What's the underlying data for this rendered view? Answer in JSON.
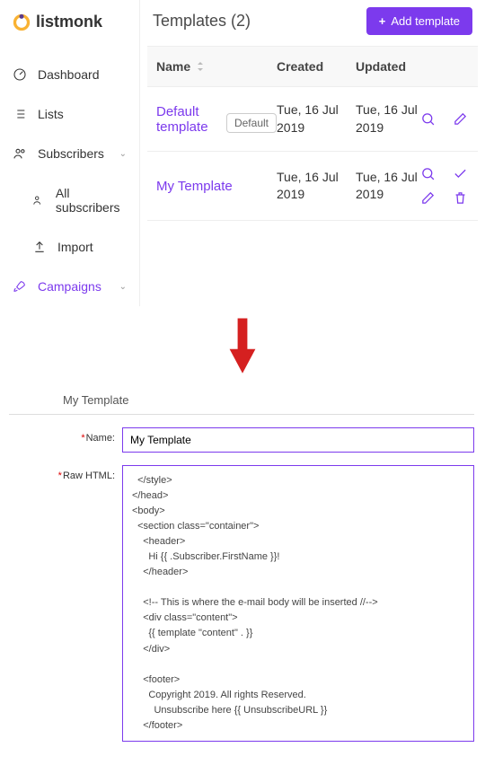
{
  "brand": "listmonk",
  "sidebar": {
    "items": [
      {
        "label": "Dashboard"
      },
      {
        "label": "Lists"
      },
      {
        "label": "Subscribers"
      },
      {
        "label": "All subscribers"
      },
      {
        "label": "Import"
      },
      {
        "label": "Campaigns"
      }
    ]
  },
  "page": {
    "title": "Templates (2)",
    "add_button": "Add template"
  },
  "table": {
    "headers": {
      "name": "Name",
      "created": "Created",
      "updated": "Updated"
    },
    "rows": [
      {
        "name": "Default template",
        "badge": "Default",
        "created": "Tue, 16 Jul 2019",
        "updated": "Tue, 16 Jul 2019"
      },
      {
        "name": "My Template",
        "badge": "",
        "created": "Tue, 16 Jul 2019",
        "updated": "Tue, 16 Jul 2019"
      }
    ]
  },
  "editor": {
    "title": "My Template",
    "name_label": "Name:",
    "name_value": "My Template",
    "html_label": "Raw HTML:",
    "html_value": "  </style>\n</head>\n<body>\n  <section class=\"container\">\n    <header>\n      Hi {{ .Subscriber.FirstName }}!\n    </header>\n\n    <!-- This is where the e-mail body will be inserted //-->\n    <div class=\"content\">\n      {{ template \"content\" . }}\n    </div>\n\n    <footer>\n      Copyright 2019. All rights Reserved.\n        Unsubscribe here {{ UnsubscribeURL }}\n    </footer>\n\n    <!-- The tracking pixel will be inserted here //-->\n    {{ TrackView }}\n  </section>"
  }
}
